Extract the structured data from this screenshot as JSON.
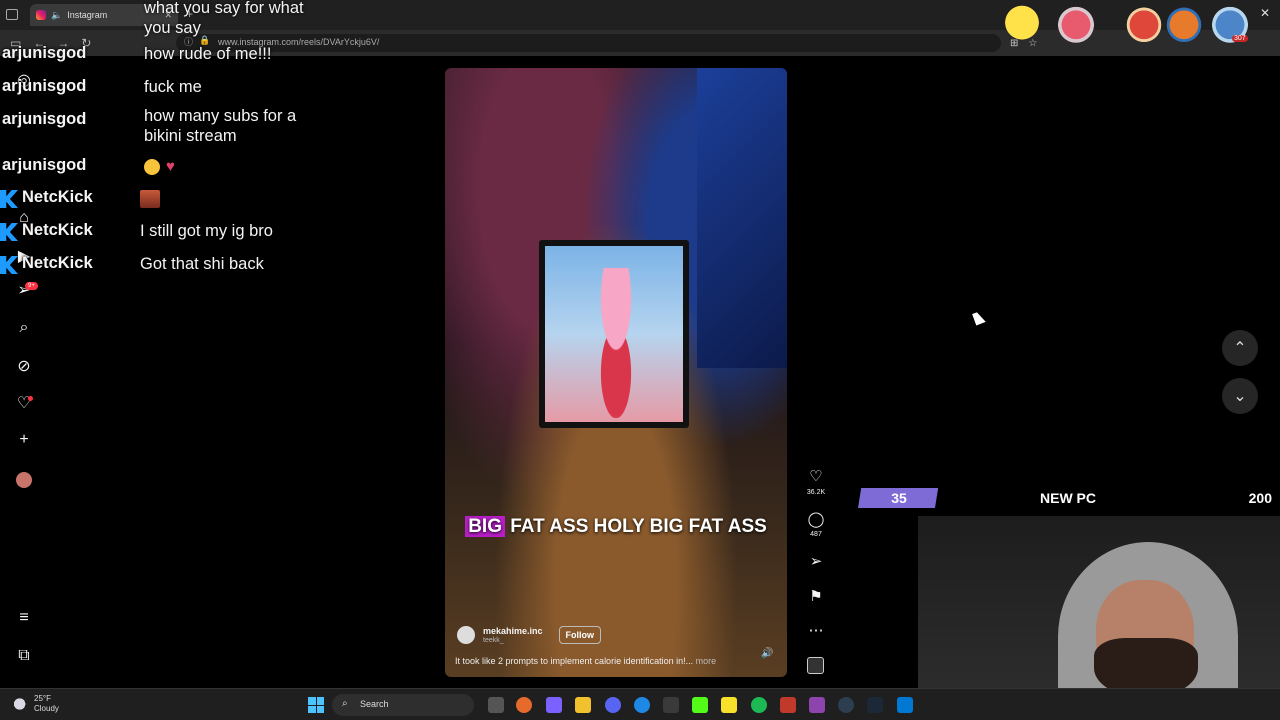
{
  "browser": {
    "tab_title": "Instagram",
    "url": "www.instagram.com/reels/DVArYckju6V/",
    "pokeball_count": "307"
  },
  "chat": {
    "messages": [
      {
        "user": "",
        "text": "what you say for what you say"
      },
      {
        "user": "arjunisgod",
        "text": "how rude of me!!!"
      },
      {
        "user": "arjunisgod",
        "text": "fuck me"
      },
      {
        "user": "arjunisgod",
        "text": "how many subs for a bikini stream"
      },
      {
        "user": "arjunisgod",
        "text": ""
      },
      {
        "user": "NetcKick",
        "text": ""
      },
      {
        "user": "NetcKick",
        "text": "I still got my ig bro"
      },
      {
        "user": "NetcKick",
        "text": "Got that shi back"
      }
    ]
  },
  "ig_nav": {
    "notification_badge": "9+"
  },
  "reel": {
    "caption_highlight": "BIG",
    "caption_rest": "FAT ASS HOLY BIG FAT ASS",
    "author": "mekahime.inc",
    "author_sub": "teekk_",
    "follow_label": "Follow",
    "description": "It took like 2 prompts to implement calorie identification in!...",
    "more_label": "more",
    "likes": "36.2K",
    "comments": "487"
  },
  "goal": {
    "current": "35",
    "label": "NEW PC",
    "target": "200",
    "progress": 0.175,
    "fill_color": "#7f6bd6"
  },
  "taskbar": {
    "temp": "25°F",
    "condition": "Cloudy",
    "search_label": "Search"
  },
  "colors": {
    "kick_brand": "#1e9bff",
    "ig_badge": "#ff3040",
    "caption_highlight": "#b81ec8"
  }
}
